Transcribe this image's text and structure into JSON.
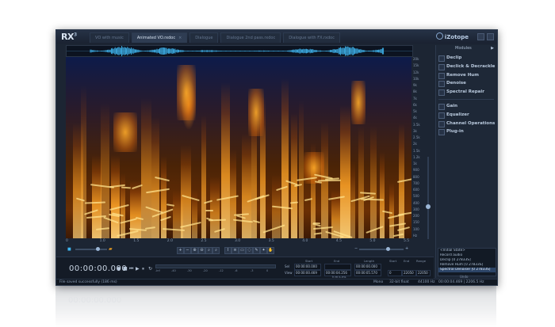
{
  "app": {
    "logo": "RX",
    "logo_version": "3",
    "brand": "iZotope"
  },
  "tabs": [
    {
      "label": "VO with music",
      "active": false
    },
    {
      "label": "Animated VO.rxdoc",
      "active": true
    },
    {
      "label": "Dialogue",
      "active": false
    },
    {
      "label": "Dialogue 2nd pass.rxdoc",
      "active": false
    },
    {
      "label": "Dialogue with FX.rxdoc",
      "active": false
    }
  ],
  "frequency_axis": [
    "20k",
    "15k",
    "12k",
    "10k",
    "9k",
    "8k",
    "7k",
    "6k",
    "5k",
    "4k",
    "3.5k",
    "3k",
    "2.5k",
    "2k",
    "1.5k",
    "1.2k",
    "1k",
    "900",
    "800",
    "700",
    "600",
    "500",
    "400",
    "300",
    "200",
    "150",
    "100",
    "Hz"
  ],
  "time_axis": [
    "0",
    "1.0",
    "1.5",
    "2.0",
    "2.5",
    "3.0",
    "3.5",
    "4.0",
    "4.5",
    "5.0",
    "5.5"
  ],
  "transport": {
    "time_display": "00:00:00.000",
    "meter_scale": [
      "-Inf",
      "-40",
      "-30",
      "-20",
      "-12",
      "-6",
      "-3",
      "0"
    ]
  },
  "selection": {
    "headers": {
      "start": "Start",
      "end": "End",
      "length": "Length"
    },
    "rows": [
      {
        "label": "Sel",
        "start": "00:00:00.000",
        "end": "",
        "length": "00:00:00.000"
      },
      {
        "label": "View",
        "start": "00:00:00.469",
        "end": "00:00:04.256",
        "length": "00:00:05.570"
      }
    ],
    "freq_headers": {
      "start": "Start",
      "end": "End",
      "range": "Range"
    },
    "freq_row": {
      "start": "0",
      "end": "22050",
      "range": "22050"
    },
    "units": "h:m:s.ms"
  },
  "modules": {
    "header": "Modules",
    "items": [
      {
        "label": "Declip",
        "icon": "declip-icon"
      },
      {
        "label": "Declick & Decrackle",
        "icon": "declick-icon"
      },
      {
        "label": "Remove Hum",
        "icon": "hum-icon"
      },
      {
        "label": "Denoise",
        "icon": "denoise-icon"
      },
      {
        "label": "Spectral Repair",
        "icon": "spectral-repair-icon"
      },
      {
        "label": "Gain",
        "icon": "gain-icon"
      },
      {
        "label": "Equalizer",
        "icon": "equalizer-icon"
      },
      {
        "label": "Channel Operations",
        "icon": "channel-icon"
      },
      {
        "label": "Plug-in",
        "icon": "plugin-icon"
      }
    ]
  },
  "history": {
    "items": [
      {
        "label": "<Initial State>",
        "selected": false
      },
      {
        "label": "Record audio",
        "selected": false
      },
      {
        "label": "Declip [0 27833S]",
        "selected": false
      },
      {
        "label": "Remove Hum [0 27833S]",
        "selected": false
      },
      {
        "label": "Spectral Denoiser [0 27833S]",
        "selected": true
      }
    ],
    "footer": "Undo"
  },
  "status": {
    "message": "File saved successfully (186 ms)",
    "channel": "Mono",
    "bitdepth": "32-bit float",
    "samplerate": "44100 Hz",
    "position": "00:00:04.469 | 2206.5 Hz"
  },
  "colors": {
    "spectrogram_hot": "#ffd27a",
    "spectrogram_mid": "#f29a24",
    "waveform": "#3fb6f0",
    "panel_bg": "#1e2837"
  }
}
